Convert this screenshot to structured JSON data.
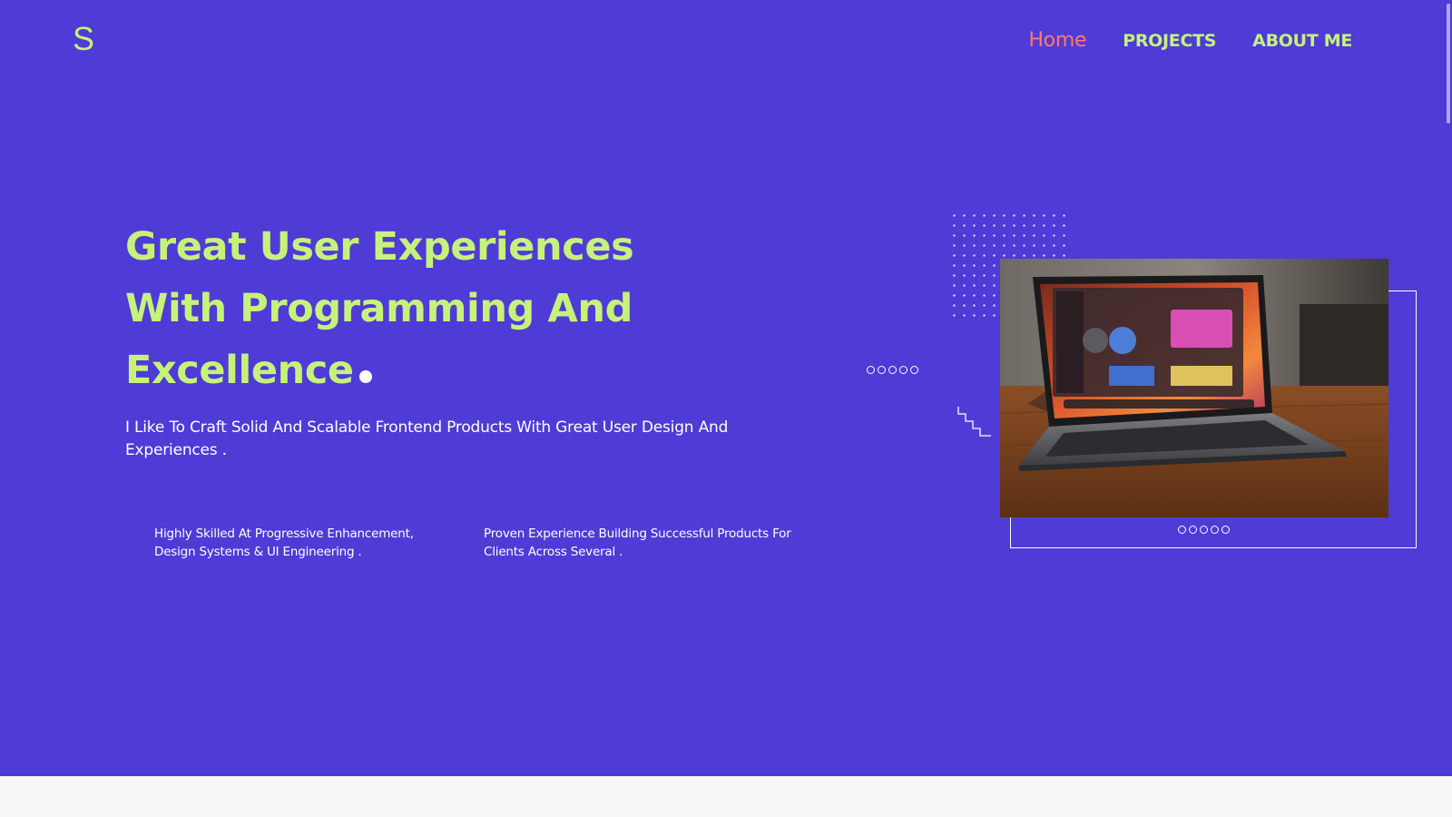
{
  "logo": "S",
  "nav": {
    "home": "Home",
    "projects": "PROJECTS",
    "about": "ABOUT ME"
  },
  "hero": {
    "title_lines": [
      "Great User Experiences",
      "With Programming And",
      "Excellence"
    ],
    "subtitle": "I Like To Craft Solid And Scalable Frontend Products With Great User Design And Experiences .",
    "features": [
      "Highly Skilled At Progressive Enhancement, Design Systems & UI Engineering .",
      "Proven Experience Building Successful Products For Clients Across Several ."
    ]
  },
  "icons": {
    "laptop_image": "laptop-photo",
    "decor_dots": "dot-grid-icon",
    "decor_circles": "circle-row-icon",
    "decor_steps": "staircase-icon"
  },
  "colors": {
    "background": "#4f3bd6",
    "accent": "#c6f27a",
    "active_nav": "#ff7a66",
    "text": "#ffffff"
  }
}
